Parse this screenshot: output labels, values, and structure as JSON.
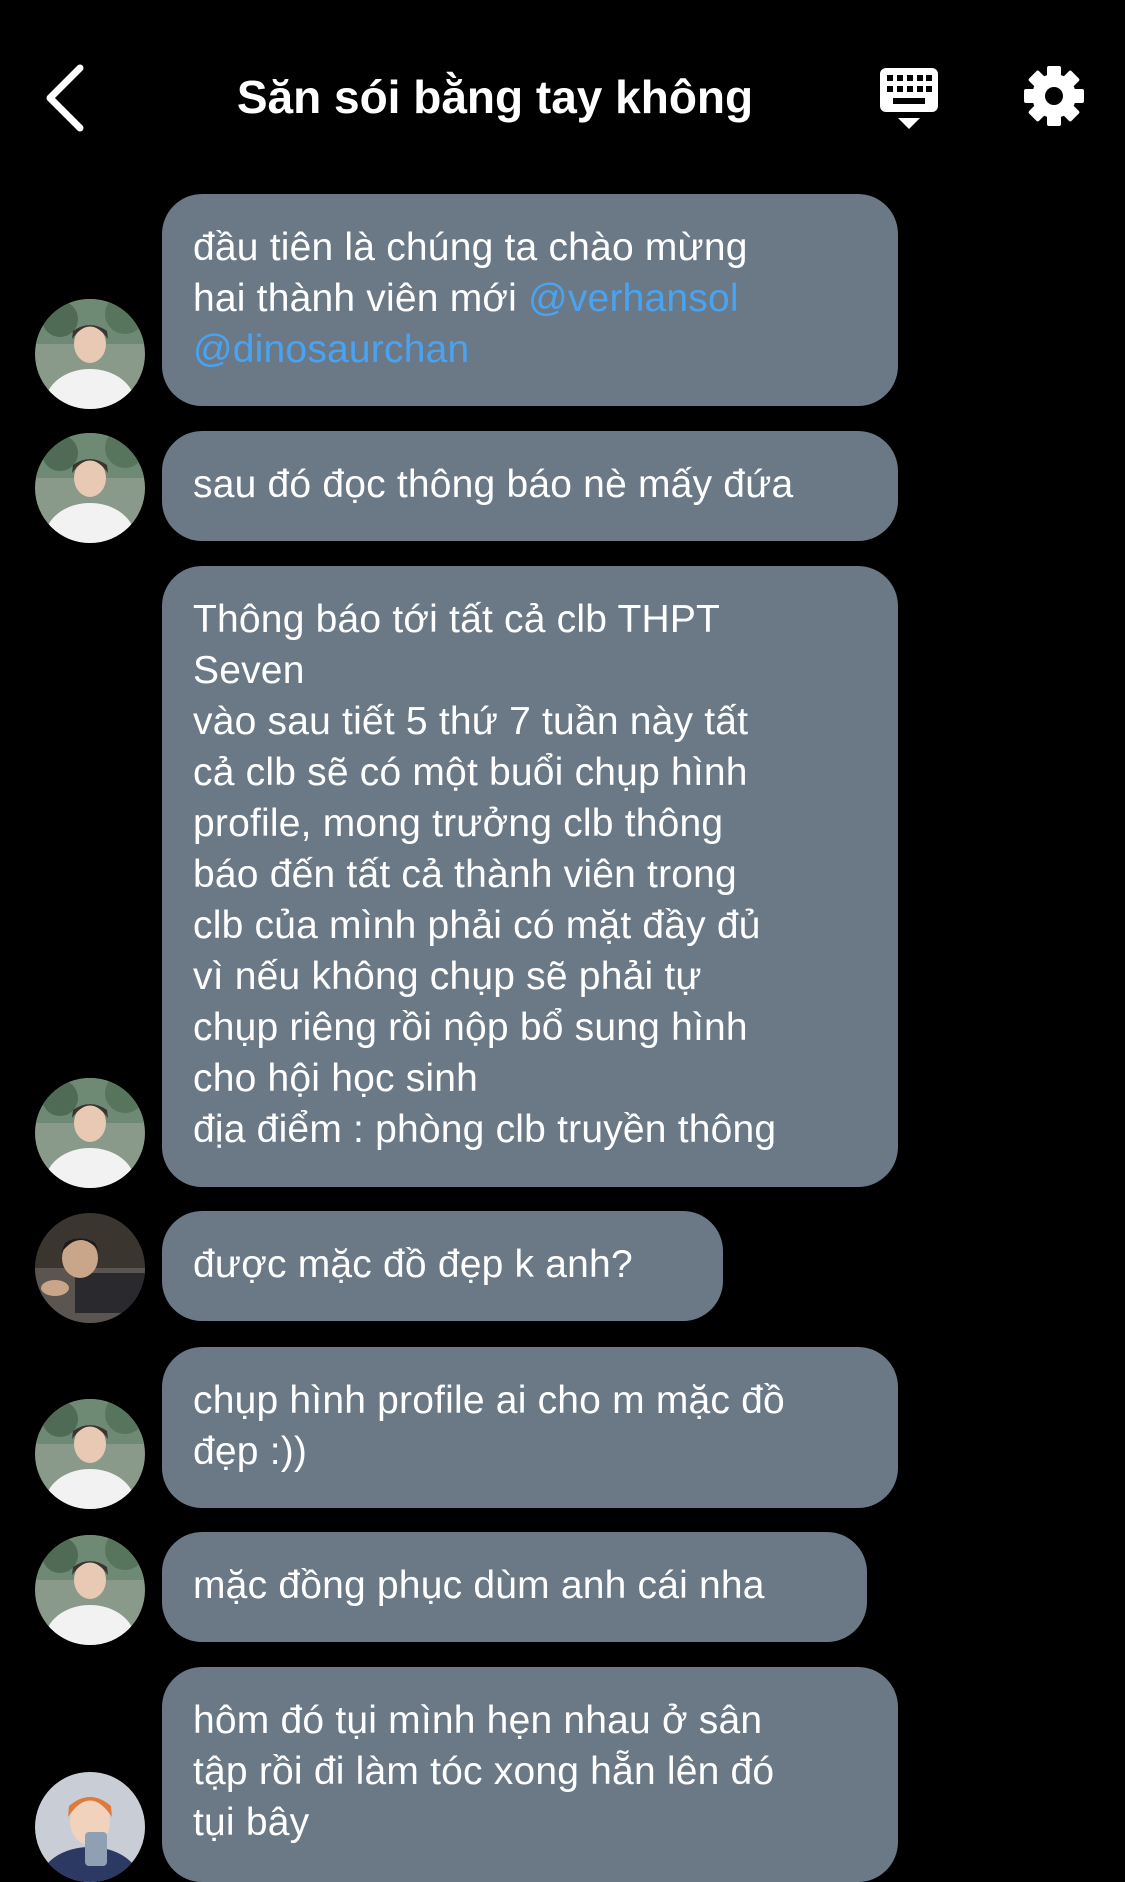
{
  "header": {
    "title": "Săn sói bằng tay không"
  },
  "colors": {
    "background": "#000000",
    "bubble": "#6b7885",
    "mention": "#4aa3f0",
    "text": "#ffffff"
  },
  "messages": [
    {
      "sender": "member-a",
      "text_line1": "đầu tiên là chúng ta chào mừng",
      "text_line2": "hai thành viên mới ",
      "mention1": "@verhansol",
      "mention2": "@dinosaurchan"
    },
    {
      "sender": "member-a",
      "text": "sau đó đọc thông báo nè mấy đứa"
    },
    {
      "sender": "member-a",
      "text": "Thông báo tới tất cả clb THPT\nSeven\nvào sau tiết 5 thứ 7 tuần này tất\ncả clb sẽ có một buổi chụp hình\nprofile, mong trưởng clb thông\nbáo đến tất cả thành viên trong\nclb của mình phải có mặt đầy đủ\nvì nếu không chụp sẽ phải tự\nchụp riêng rồi nộp bổ sung hình\ncho hội học sinh\nđịa điểm : phòng clb truyền thông"
    },
    {
      "sender": "member-b",
      "text": "được mặc đồ đẹp k anh?"
    },
    {
      "sender": "member-a",
      "text": "chụp hình profile ai cho m mặc đồ\nđẹp :))"
    },
    {
      "sender": "member-a",
      "text": "mặc đồng phục dùm anh cái nha"
    },
    {
      "sender": "member-c",
      "text": "hôm đó tụi mình hẹn nhau ở sân\ntập rồi đi làm tóc xong hẵn lên đó\ntụi bây"
    }
  ]
}
